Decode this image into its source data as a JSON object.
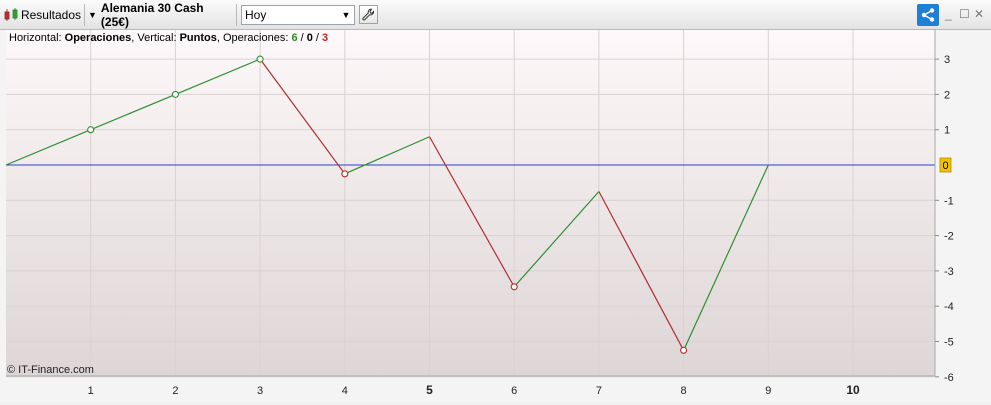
{
  "toolbar": {
    "results_label": "Resultados",
    "instrument_label": "Alemania 30 Cash (25€)",
    "period_value": "Hoy",
    "icons": [
      "candlestick-icon",
      "dropdown-caret-icon",
      "wrench-icon",
      "share-icon",
      "minimize-icon",
      "maximize-icon",
      "close-icon"
    ],
    "accent_color": "#1f7ed6"
  },
  "info": {
    "horizontal_label": "Horizontal: ",
    "horizontal_value": "Operaciones",
    "vertical_label": ", Vertical: ",
    "vertical_value": "Puntos",
    "ops_label": ", Operaciones: ",
    "ops_win": "6",
    "ops_sep1": " / ",
    "ops_neutral": "0",
    "ops_sep2": " / ",
    "ops_loss": "3"
  },
  "copyright": "© IT-Finance.com",
  "chart_data": {
    "type": "line",
    "title": "",
    "xlabel": "",
    "ylabel": "",
    "x": [
      0,
      1,
      2,
      3,
      4,
      5,
      6,
      7,
      8,
      9
    ],
    "y": [
      0,
      1,
      2,
      3,
      -0.25,
      0.8,
      -3.45,
      -0.75,
      -5.25,
      0
    ],
    "trade_points_x": [
      1,
      2,
      3,
      4,
      6,
      8
    ],
    "xlim": [
      0,
      11
    ],
    "ylim": [
      -6,
      3.8
    ],
    "x_ticks": [
      "1",
      "2",
      "3",
      "4",
      "5",
      "6",
      "7",
      "8",
      "9",
      "10"
    ],
    "bold_x_ticks": [
      "5",
      "10"
    ],
    "y_ticks": [
      "3",
      "2",
      "1",
      "0",
      "-1",
      "-2",
      "-3",
      "-4",
      "-5",
      "-6"
    ],
    "zero_label": "0",
    "baseline": 0,
    "grid": true,
    "colors": {
      "up": "#2f8f2f",
      "down": "#b52b2b",
      "baseline": "#2a3fd6",
      "zero_badge": "#f2c200"
    }
  }
}
